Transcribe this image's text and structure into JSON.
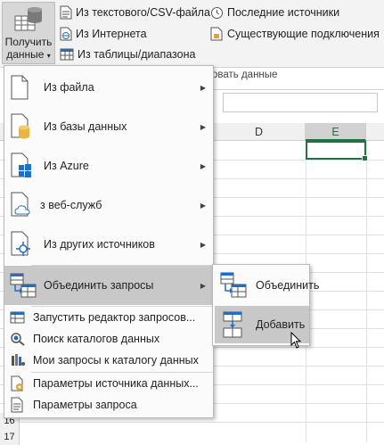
{
  "ribbon": {
    "get_data_button": {
      "line1": "Получить",
      "line2": "данные",
      "caret": "▾"
    },
    "items": {
      "from_text_csv": "Из текстового/CSV-файла",
      "from_web": "Из Интернета",
      "from_table": "Из таблицы/диапазона",
      "recent_sources": "Последние источники",
      "existing_connections": "Существующие подключения"
    },
    "group_label_fragment": "овать данные"
  },
  "sheet": {
    "columns": [
      "D",
      "E"
    ],
    "active_column": "E",
    "row_numbers": [
      "16",
      "17"
    ]
  },
  "menu": {
    "items": [
      {
        "label": "Из файла",
        "icon": "file-icon",
        "has_submenu": true
      },
      {
        "label": "Из базы данных",
        "icon": "database-icon",
        "has_submenu": true
      },
      {
        "label": "Из Azure",
        "icon": "azure-windows-icon",
        "has_submenu": true
      },
      {
        "label": "з веб-служб",
        "icon": "cloud-doc-icon",
        "has_submenu": true
      },
      {
        "label": "Из других источников",
        "icon": "network-icon",
        "has_submenu": true
      },
      {
        "label": "Объединить запросы",
        "icon": "combine-tables-icon",
        "has_submenu": true,
        "highlighted": true
      },
      {
        "label": "Запустить редактор запросов...",
        "icon": "query-editor-icon"
      },
      {
        "label": "Поиск каталогов данных",
        "icon": "catalog-search-icon"
      },
      {
        "label": "Мои запросы к каталогу данных",
        "icon": "catalog-queries-icon"
      },
      {
        "label": "Параметры источника данных...",
        "icon": "source-settings-icon"
      },
      {
        "label": "Параметры запроса",
        "icon": "query-settings-icon"
      }
    ]
  },
  "submenu": {
    "items": [
      {
        "label": "Объединить",
        "icon": "merge-icon"
      },
      {
        "label": "Добавить",
        "icon": "append-icon",
        "highlighted": true
      }
    ]
  },
  "colors": {
    "excel_green": "#217346",
    "menu_highlight": "#c8c8c8",
    "menu_bg": "#fbfbfb"
  }
}
